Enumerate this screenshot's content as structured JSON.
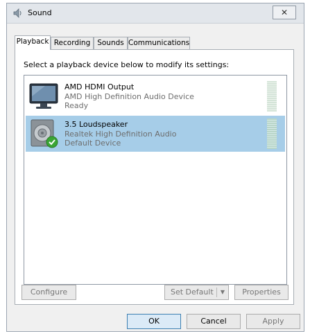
{
  "window": {
    "title": "Sound",
    "close_glyph": "✕"
  },
  "tabs": [
    {
      "label": "Playback",
      "active": true
    },
    {
      "label": "Recording",
      "active": false
    },
    {
      "label": "Sounds",
      "active": false
    },
    {
      "label": "Communications",
      "active": false
    }
  ],
  "panel": {
    "instruction": "Select a playback device below to modify its settings:"
  },
  "devices": [
    {
      "name": "AMD HDMI Output",
      "driver": "AMD High Definition Audio Device",
      "status": "Ready",
      "icon": "monitor-icon",
      "selected": false
    },
    {
      "name": "3.5 Loudspeaker",
      "driver": "Realtek High Definition Audio",
      "status": "Default Device",
      "icon": "speaker-icon",
      "selected": true
    }
  ],
  "buttons": {
    "configure": "Configure",
    "set_default": "Set Default",
    "properties": "Properties",
    "ok": "OK",
    "cancel": "Cancel",
    "apply": "Apply"
  },
  "colors": {
    "selection": "#a6cde8",
    "accent": "#3c7fb1",
    "check": "#3aa535"
  }
}
